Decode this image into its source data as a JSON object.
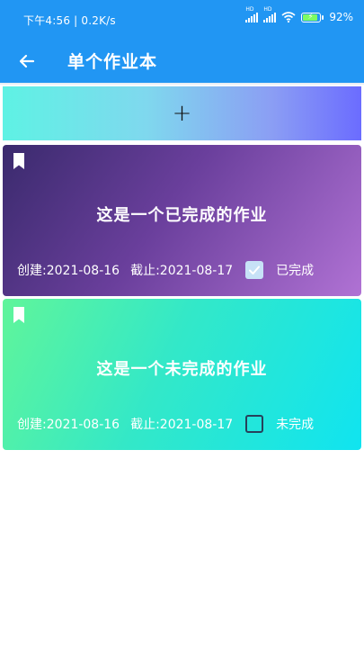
{
  "status_bar": {
    "time_and_speed": "下午4:56 | 0.2K/s",
    "signal_labels": [
      "HD",
      "HD"
    ],
    "battery_percent": "92%",
    "battery_level": 0.92
  },
  "app_bar": {
    "title": "单个作业本",
    "back_icon": "arrow-back-icon"
  },
  "add_button": {
    "label": "+"
  },
  "homework": [
    {
      "title": "这是一个已完成的作业",
      "created": "创建:2021-08-16",
      "deadline": "截止:2021-08-17",
      "checked": true,
      "status": "已完成"
    },
    {
      "title": "这是一个未完成的作业",
      "created": "创建:2021-08-16",
      "deadline": "截止:2021-08-17",
      "checked": false,
      "status": "未完成"
    }
  ],
  "colors": {
    "app_bar": "#2196F3",
    "checkbox_checked": "#c7e2f7",
    "battery_fill": "#7CFC64"
  }
}
